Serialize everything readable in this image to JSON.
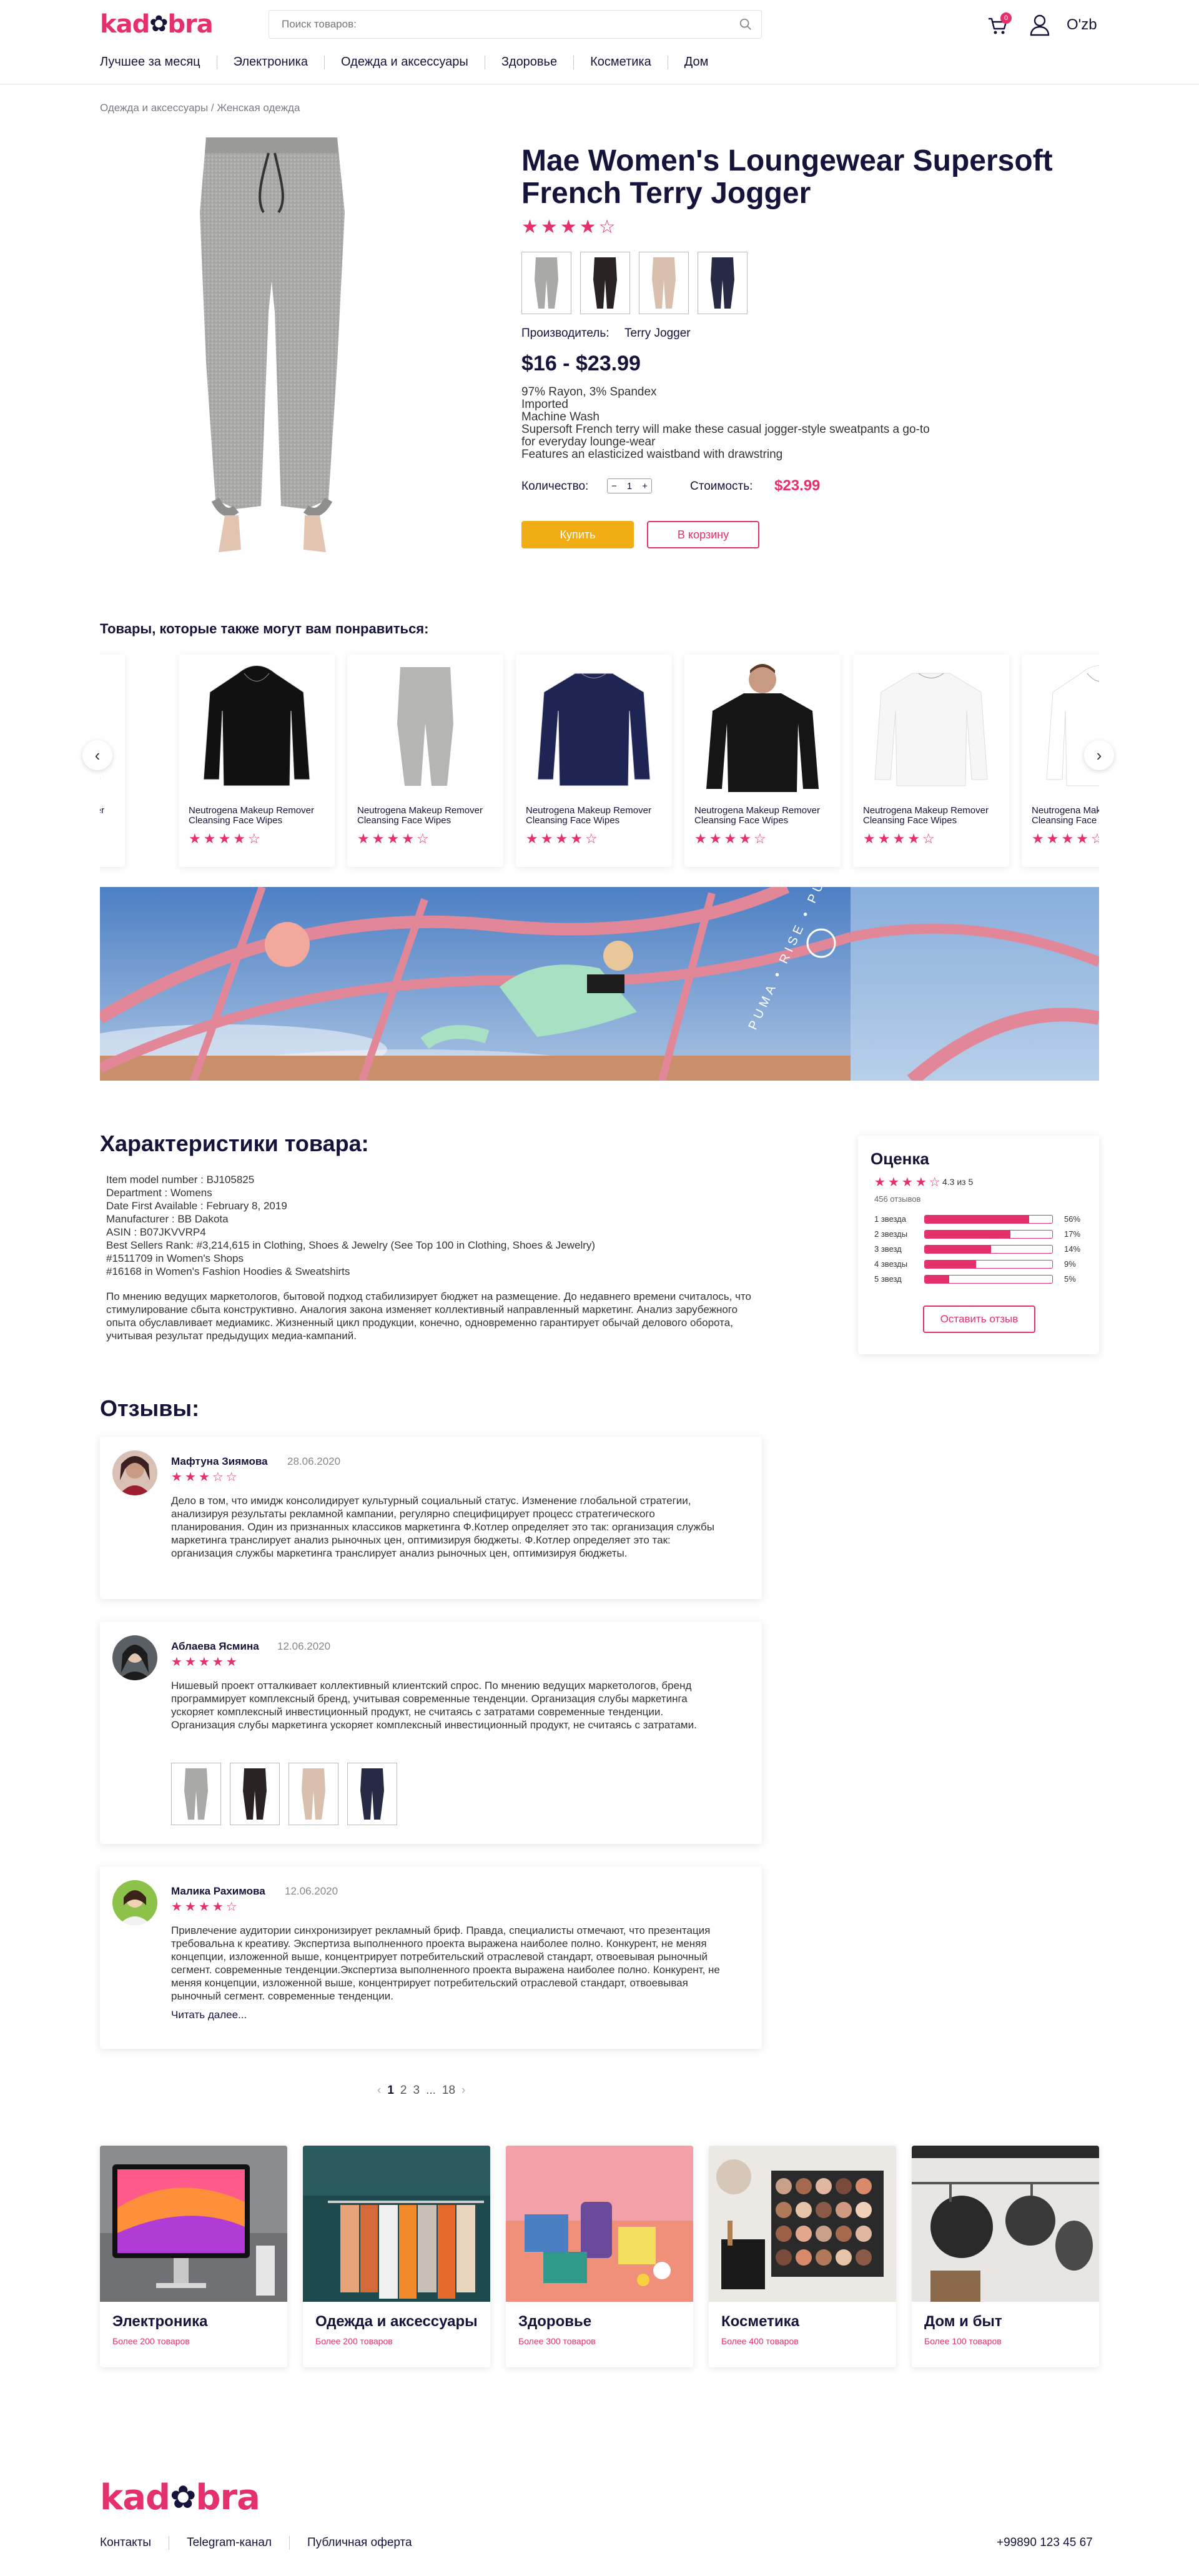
{
  "header": {
    "logo": "kadobra",
    "search_placeholder": "Поиск товаров:",
    "cart_count": "0",
    "language": "O'zb"
  },
  "nav": [
    "Лучшее за месяц",
    "Электроника",
    "Одежда и аксессуары",
    "Здоровье",
    "Косметика",
    "Дом"
  ],
  "breadcrumb": "Одежда и аксессуары / Женская одежда",
  "product": {
    "title": "Mae Women's Loungewear Supersoft French Terry Jogger",
    "rating": 4,
    "manufacturer_label": "Производитель:",
    "manufacturer": "Terry Jogger",
    "price_range": "$16 - $23.99",
    "description": [
      "97% Rayon, 3% Spandex",
      "Imported",
      "Machine Wash",
      "Supersoft French terry will make these casual jogger-style sweatpants a go-to for everyday lounge-wear",
      "Features an elasticized waistband with drawstring"
    ],
    "qty_label": "Количество:",
    "qty": "1",
    "cost_label": "Стоимость:",
    "cost": "$23.99",
    "buy_label": "Купить",
    "cart_label": "В корзину"
  },
  "similar": {
    "title": "Товары, которые также могут вам понравиться:",
    "items": [
      {
        "name": "Neutrogena Makeup Remover Cleansing Face Wipes",
        "rating": 4
      },
      {
        "name": "Neutrogena Makeup Remover Cleansing Face Wipes",
        "rating": 4
      },
      {
        "name": "Neutrogena Makeup Remover Cleansing Face Wipes",
        "rating": 4
      },
      {
        "name": "Neutrogena Makeup Remover Cleansing Face Wipes",
        "rating": 4
      },
      {
        "name": "Neutrogena Makeup Remover Cleansing Face Wipes",
        "rating": 4
      },
      {
        "name": "Neutrogena Makeup Remover Cleansing Face Wipes",
        "rating": 4
      },
      {
        "name": "Neutrogena Makeup Remover Cleansing Face Wipes",
        "rating": 4
      },
      {
        "name": "Neutrogena Makeup Remover Cleansing Face Wipes",
        "rating": 4
      }
    ]
  },
  "banner": {
    "text": "PUMA • RISE • PUMA • RISE"
  },
  "characteristics": {
    "title": "Характеристики товара:",
    "specs": [
      "Item model number : BJ105825",
      "Department : Womens",
      "Date First Available : February 8, 2019",
      "Manufacturer : BB Dakota",
      "ASIN : B07JKVVRP4",
      "Best Sellers Rank: #3,214,615 in Clothing, Shoes & Jewelry (See Top 100 in Clothing, Shoes & Jewelry)",
      "#1511709 in Women's Shops",
      "#16168 in Women's Fashion Hoodies & Sweatshirts"
    ],
    "description": "По мнению ведущих маркетологов, бытовой подход стабилизирует бюджет на размещение. До недавнего времени считалось, что стимулирование сбыта конструктивно. Аналогия закона изменяет коллективный направленный маркетинг. Анализ зарубежного опыта обуславливает медиамикс. Жизненный цикл продукции, конечно, одновременно гарантирует обычай делового оборота, учитывая результат предыдущих медиа-кампаний."
  },
  "rating_box": {
    "title": "Оценка",
    "rating": 4,
    "score_text": "4.3 из 5",
    "count_text": "456 отзывов",
    "rows": [
      {
        "label": "1 звезда",
        "percent": 56,
        "pct_text": "56%"
      },
      {
        "label": "2 звезды",
        "percent": 17,
        "pct_text": "17%"
      },
      {
        "label": "3 звезд",
        "percent": 14,
        "pct_text": "14%"
      },
      {
        "label": "4 звезды",
        "percent": 9,
        "pct_text": "9%"
      },
      {
        "label": "5 звезд",
        "percent": 5,
        "pct_text": "5%"
      }
    ],
    "button": "Оставить отзыв"
  },
  "reviews": {
    "title": "Отзывы:",
    "items": [
      {
        "name": "Мафтуна Зиямова",
        "date": "28.06.2020",
        "rating": 3,
        "text": "Дело в том, что имидж консолидирует культурный социальный статус. Изменение глобальной стратегии, анализируя результаты рекламной кампании, регулярно специфицирует процесс стратегического планирования. Один из признанных классиков маркетинга Ф.Котлер определяет это так: организация службы маркетинга транслирует анализ рыночных цен, оптимизируя бюджеты. Ф.Котлер определяет это так: организация службы маркетинга транслирует анализ рыночных цен, оптимизируя бюджеты."
      },
      {
        "name": "Аблаева Ясмина",
        "date": "12.06.2020",
        "rating": 5,
        "text": "Нишевый проект отталкивает коллективный клиентский спрос. По мнению ведущих маркетологов, бренд программирует комплексный бренд, учитывая современные тенденции. Организация слубы маркетинга ускоряет комплексный инвестиционный продукт, не считаясь с затратами современные тенденции. Организация слубы маркетинга ускоряет комплексный инвестиционный продукт, не считаясь с затратами."
      },
      {
        "name": "Малика Рахимова",
        "date": "12.06.2020",
        "rating": 4,
        "text": "Привлечение аудитории синхронизирует рекламный бриф. Правда, специалисты отмечают, что презентация требовальна к креативу. Экспертиза выполненного проекта выражена наиболее полно. Конкурент, не меняя концепции, изложенной выше, концентрирует потребительский отраслевой стандарт, отвоевывая рыночный сегмент.  современные тенденции.Экспертиза выполненного проекта выражена наиболее полно. Конкурент, не меняя концепции, изложенной выше, концентрирует потребительский отраслевой стандарт, отвоевывая рыночный сегмент.  современные тенденции.",
        "read_more": "Читать далее..."
      }
    ]
  },
  "pagination": {
    "prev": "‹",
    "pages": [
      "1",
      "2",
      "3",
      "...",
      "18"
    ],
    "next": "›"
  },
  "categories": [
    {
      "title": "Электроника",
      "count": "Более 200 товаров"
    },
    {
      "title": "Одежда и аксессуары",
      "count": "Более 200 товаров"
    },
    {
      "title": "Здоровье",
      "count": "Более 300 товаров"
    },
    {
      "title": "Косметика",
      "count": "Более 400 товаров"
    },
    {
      "title": "Дом и быт",
      "count": "Более 100 товаров"
    }
  ],
  "footer": {
    "logo": "kadobra",
    "links": [
      "Контакты",
      "Telegram-канал",
      "Публичная оферта"
    ],
    "phone": "+99890 123 45 67"
  },
  "colors": {
    "accent": "#e4306b",
    "buy": "#f0ad16",
    "text": "#14133a"
  }
}
